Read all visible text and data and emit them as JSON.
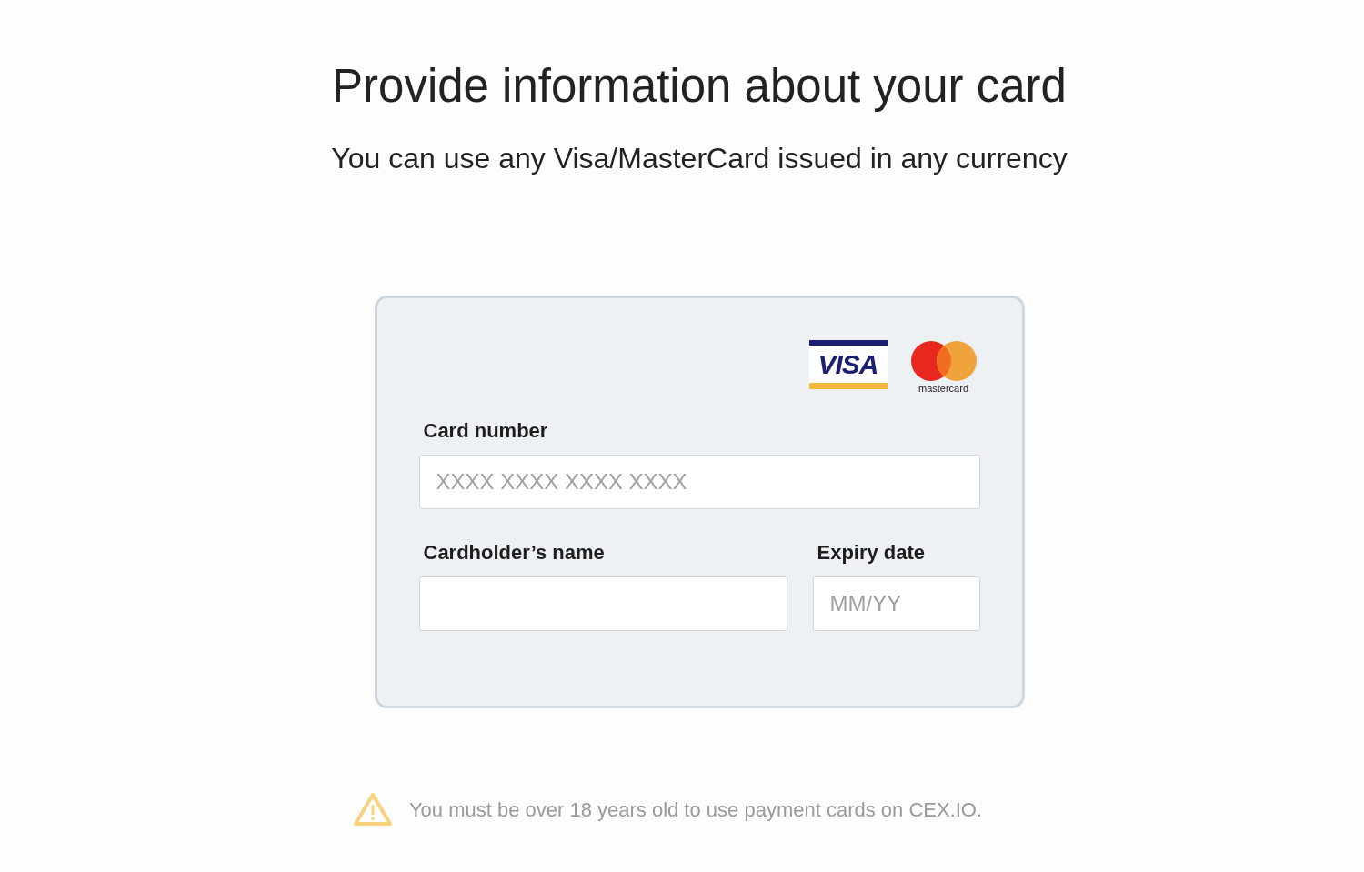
{
  "header": {
    "title": "Provide information about your card",
    "subtitle": "You can use any Visa/MasterCard issued in any currency"
  },
  "card_form": {
    "logos": [
      {
        "kind": "visa",
        "text": "VISA"
      },
      {
        "kind": "mastercard",
        "text": "mastercard"
      }
    ],
    "fields": [
      {
        "label": "Card number",
        "placeholder": "XXXX XXXX XXXX XXXX"
      },
      {
        "label": "Cardholder’s name"
      },
      {
        "label": "Expiry date",
        "placeholder": "MM/YY"
      }
    ]
  },
  "notice": {
    "text": "You must be over 18 years old to use payment cards on CEX.IO."
  }
}
